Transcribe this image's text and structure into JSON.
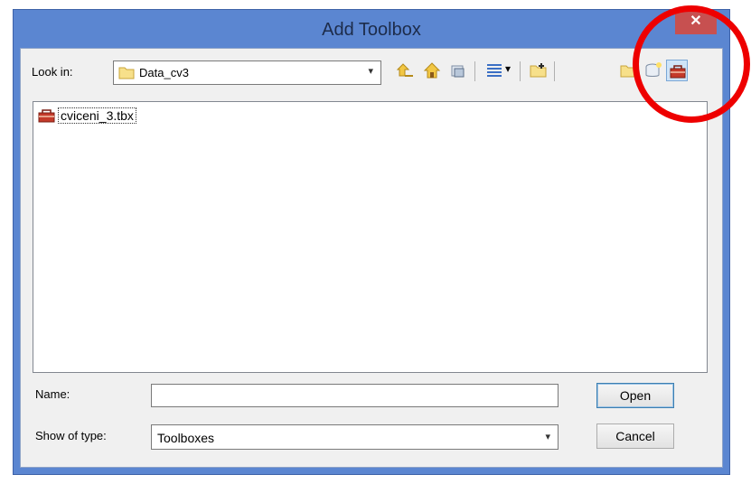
{
  "window": {
    "title": "Add Toolbox",
    "close_label": "✕"
  },
  "look_in": {
    "label": "Look in:",
    "value": "Data_cv3"
  },
  "toolbar": {
    "icons": [
      "up-one-level-icon",
      "home-icon",
      "connect-folder-icon",
      "view-menu-icon",
      "new-folder-icon",
      "folder-icon",
      "new-geodatabase-icon",
      "new-toolbox-icon"
    ]
  },
  "files": [
    {
      "name": "cviceni_3.tbx",
      "icon": "toolbox-icon"
    }
  ],
  "form": {
    "name_label": "Name:",
    "name_value": "",
    "type_label": "Show of type:",
    "type_value": "Toolboxes"
  },
  "buttons": {
    "open": "Open",
    "cancel": "Cancel"
  },
  "colors": {
    "title_bar": "#5b86d1",
    "close": "#c75050",
    "annotation": "#ee0000"
  }
}
